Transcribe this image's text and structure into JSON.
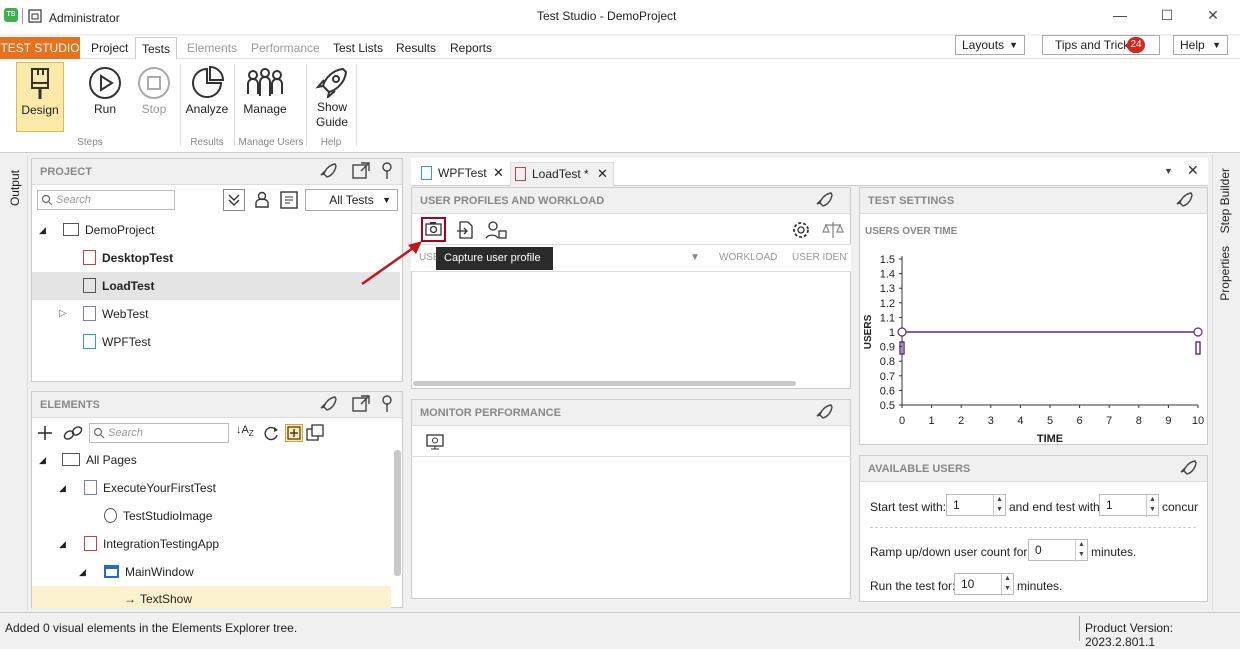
{
  "window": {
    "user": "Administrator",
    "title": "Test Studio - DemoProject"
  },
  "menu": {
    "brand": "TEST STUDIO",
    "items": [
      "Project",
      "Tests",
      "Elements",
      "Performance",
      "Test Lists",
      "Results",
      "Reports"
    ],
    "layouts": "Layouts",
    "tips": "Tips and Tricks",
    "tips_count": "24",
    "help": "Help"
  },
  "ribbon": {
    "design": "Design",
    "run": "Run",
    "stop": "Stop",
    "analyze": "Analyze",
    "manage": "Manage",
    "show_guide_1": "Show",
    "show_guide_2": "Guide",
    "groups": {
      "steps": "Steps",
      "results": "Results",
      "manage_users": "Manage Users",
      "help": "Help"
    }
  },
  "side": {
    "output": "Output",
    "step_builder": "Step Builder",
    "properties": "Properties"
  },
  "project": {
    "header": "PROJECT",
    "search_placeholder": "Search",
    "filter": "All Tests",
    "items": [
      {
        "label": "DemoProject"
      },
      {
        "label": "DesktopTest"
      },
      {
        "label": "LoadTest"
      },
      {
        "label": "WebTest"
      },
      {
        "label": "WPFTest"
      }
    ]
  },
  "elements": {
    "header": "ELEMENTS",
    "search_placeholder": "Search",
    "items": [
      {
        "label": "All Pages"
      },
      {
        "label": "ExecuteYourFirstTest"
      },
      {
        "label": "TestStudioImage"
      },
      {
        "label": "IntegrationTestingApp"
      },
      {
        "label": "MainWindow"
      },
      {
        "label": "TextShow"
      }
    ]
  },
  "doctabs": [
    {
      "label": "WPFTest"
    },
    {
      "label": "LoadTest *"
    }
  ],
  "profiles": {
    "header": "USER PROFILES AND WORKLOAD",
    "tooltip": "Capture user profile",
    "col_user": "USE",
    "col_workload": "WORKLOAD",
    "col_identity": "USER IDENTI"
  },
  "monitor": {
    "header": "MONITOR PERFORMANCE"
  },
  "settings": {
    "header": "TEST SETTINGS",
    "chart_title": "USERS OVER TIME"
  },
  "available": {
    "header": "AVAILABLE USERS",
    "start_label": "Start test with:",
    "start_value": "1",
    "end_label": "and end test with",
    "end_value": "1",
    "end_suffix": "concurr",
    "ramp_label": "Ramp up/down user count for:",
    "ramp_value": "0",
    "ramp_suffix": "minutes.",
    "run_label": "Run the test for:",
    "run_value": "10",
    "run_suffix": "minutes."
  },
  "status": {
    "message": "Added 0 visual elements in the Elements Explorer tree.",
    "version": "Product Version: 2023.2.801.1"
  },
  "chart_data": {
    "type": "line",
    "title": "USERS OVER TIME",
    "xlabel": "TIME",
    "ylabel": "USERS",
    "x_ticks": [
      "0",
      "1",
      "2",
      "3",
      "4",
      "5",
      "6",
      "7",
      "8",
      "9",
      "10"
    ],
    "y_ticks": [
      "1.5",
      "1.4",
      "1.3",
      "1.2",
      "1.1",
      "1",
      "0.9",
      "0.8",
      "0.7",
      "0.6",
      "0.5"
    ],
    "xlim": [
      0,
      10
    ],
    "ylim": [
      0.5,
      1.5
    ],
    "series": [
      {
        "x": [
          0,
          10
        ],
        "y": [
          1,
          1
        ]
      }
    ]
  }
}
